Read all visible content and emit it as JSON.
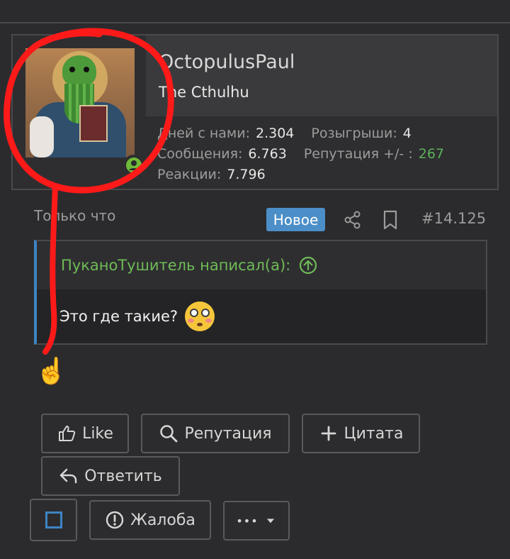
{
  "user": {
    "username": "OctopulusPaul",
    "title": "The Cthulhu",
    "stats": {
      "days_label": "Дней с нами:",
      "days_value": "2.304",
      "giveaways_label": "Розыгрыши:",
      "giveaways_value": "4",
      "messages_label": "Сообщения:",
      "messages_value": "6.763",
      "reputation_label": "Репутация +/- :",
      "reputation_value": "267",
      "reactions_label": "Реакции:",
      "reactions_value": "7.796"
    }
  },
  "post": {
    "time": "Только что",
    "new_badge": "Новое",
    "number": "#14.125",
    "quote_author": "ПуканоТушитель написал(а):",
    "quote_text": "Это где такие?",
    "body_emoji": "☝️"
  },
  "actions": {
    "like": "Like",
    "reputation": "Репутация",
    "quote": "Цитата",
    "reply": "Ответить",
    "report": "Жалоба",
    "more": "•••"
  },
  "colors": {
    "accent_blue": "#4c8fc8",
    "green": "#5cb05c",
    "annotation_red": "#ff1a1a"
  }
}
